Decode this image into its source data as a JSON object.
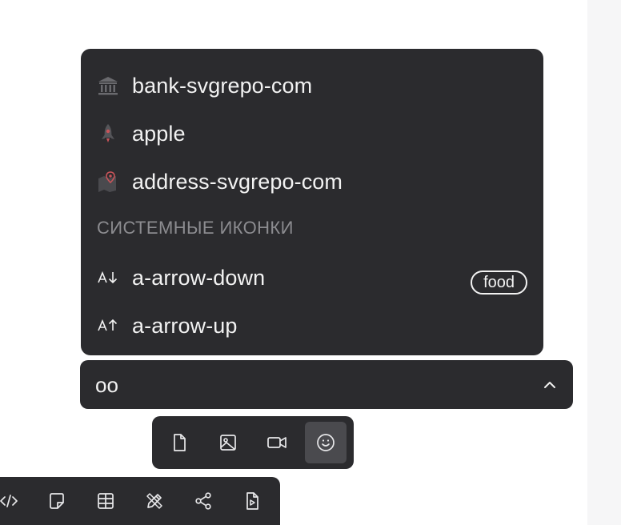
{
  "dropdown": {
    "items": [
      {
        "label": "bank-svgrepo-com",
        "icon": "bank-icon"
      },
      {
        "label": "apple",
        "icon": "rocket-icon"
      },
      {
        "label": "address-svgrepo-com",
        "icon": "map-pin-icon"
      }
    ],
    "section_title": "СИСТЕМНЫЕ ИКОНКИ",
    "system_items": [
      {
        "label": "a-arrow-down",
        "icon": "a-arrow-down-icon",
        "badge": "food"
      },
      {
        "label": "a-arrow-up",
        "icon": "a-arrow-up-icon"
      }
    ]
  },
  "select": {
    "value": "oo",
    "icon": "chevron-up-icon"
  },
  "media_toolbar": {
    "buttons": [
      "file-icon",
      "image-icon",
      "video-icon",
      "smile-icon"
    ],
    "active": "smile-icon"
  },
  "insert_toolbar": {
    "buttons": [
      "code-icon",
      "sticky-note-icon",
      "table-icon",
      "draw-tools-icon",
      "share-icon",
      "video-file-icon"
    ]
  },
  "colors": {
    "panel": "#2b2b2e",
    "text": "#f2f2f2",
    "muted": "#8c8c90",
    "active": "#4a4a4e",
    "accent_red": "#c9545a"
  }
}
